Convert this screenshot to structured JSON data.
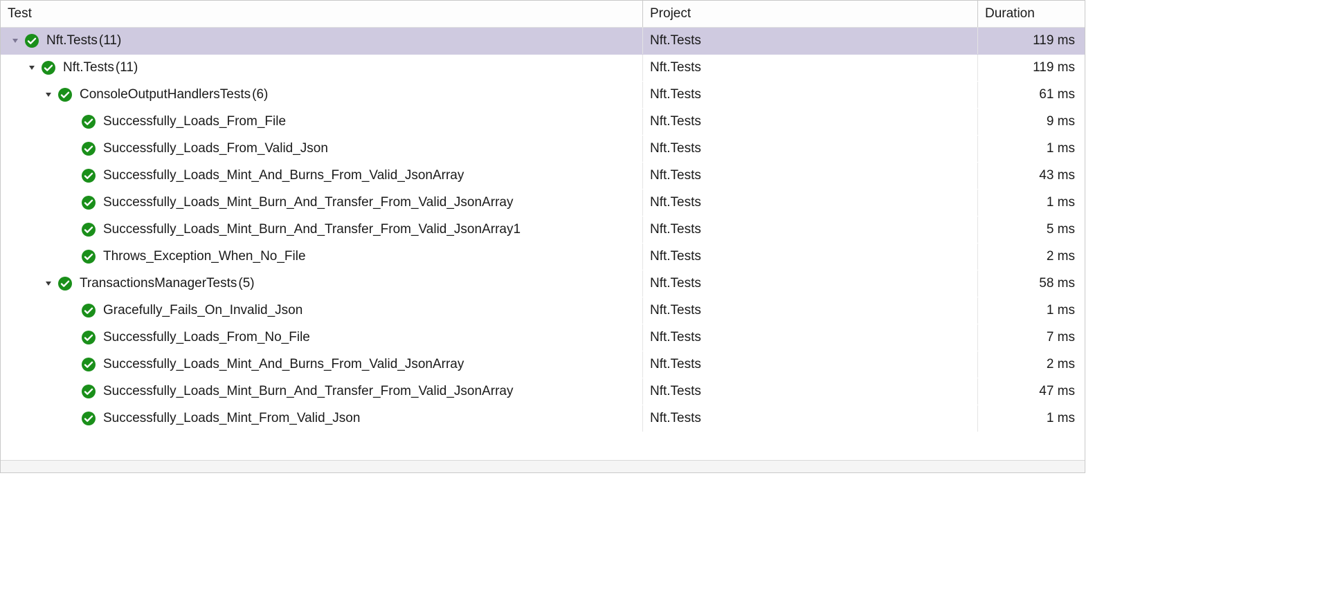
{
  "columns": {
    "test": "Test",
    "project": "Project",
    "duration": "Duration"
  },
  "rows": [
    {
      "id": "root",
      "indent": 0,
      "expander": "open-light",
      "status": "pass",
      "name": "Nft.Tests",
      "count": "(11)",
      "project": "Nft.Tests",
      "duration": "119 ms",
      "selected": true,
      "interactable": true
    },
    {
      "id": "ns",
      "indent": 1,
      "expander": "open",
      "status": "pass",
      "name": "Nft.Tests",
      "count": "(11)",
      "project": "Nft.Tests",
      "duration": "119 ms",
      "selected": false,
      "interactable": true
    },
    {
      "id": "cls1",
      "indent": 2,
      "expander": "open",
      "status": "pass",
      "name": "ConsoleOutputHandlersTests",
      "count": "(6)",
      "project": "Nft.Tests",
      "duration": "61 ms",
      "selected": false,
      "interactable": true
    },
    {
      "id": "t1",
      "indent": 3,
      "expander": "none",
      "status": "pass",
      "name": "Successfully_Loads_From_File",
      "count": "",
      "project": "Nft.Tests",
      "duration": "9 ms",
      "selected": false,
      "interactable": true
    },
    {
      "id": "t2",
      "indent": 3,
      "expander": "none",
      "status": "pass",
      "name": "Successfully_Loads_From_Valid_Json",
      "count": "",
      "project": "Nft.Tests",
      "duration": "1 ms",
      "selected": false,
      "interactable": true
    },
    {
      "id": "t3",
      "indent": 3,
      "expander": "none",
      "status": "pass",
      "name": "Successfully_Loads_Mint_And_Burns_From_Valid_JsonArray",
      "count": "",
      "project": "Nft.Tests",
      "duration": "43 ms",
      "selected": false,
      "interactable": true
    },
    {
      "id": "t4",
      "indent": 3,
      "expander": "none",
      "status": "pass",
      "name": "Successfully_Loads_Mint_Burn_And_Transfer_From_Valid_JsonArray",
      "count": "",
      "project": "Nft.Tests",
      "duration": "1 ms",
      "selected": false,
      "interactable": true
    },
    {
      "id": "t5",
      "indent": 3,
      "expander": "none",
      "status": "pass",
      "name": "Successfully_Loads_Mint_Burn_And_Transfer_From_Valid_JsonArray1",
      "count": "",
      "project": "Nft.Tests",
      "duration": "5 ms",
      "selected": false,
      "interactable": true
    },
    {
      "id": "t6",
      "indent": 3,
      "expander": "none",
      "status": "pass",
      "name": "Throws_Exception_When_No_File",
      "count": "",
      "project": "Nft.Tests",
      "duration": "2 ms",
      "selected": false,
      "interactable": true
    },
    {
      "id": "cls2",
      "indent": 2,
      "expander": "open",
      "status": "pass",
      "name": "TransactionsManagerTests",
      "count": "(5)",
      "project": "Nft.Tests",
      "duration": "58 ms",
      "selected": false,
      "interactable": true
    },
    {
      "id": "t7",
      "indent": 3,
      "expander": "none",
      "status": "pass",
      "name": "Gracefully_Fails_On_Invalid_Json",
      "count": "",
      "project": "Nft.Tests",
      "duration": "1 ms",
      "selected": false,
      "interactable": true
    },
    {
      "id": "t8",
      "indent": 3,
      "expander": "none",
      "status": "pass",
      "name": "Successfully_Loads_From_No_File",
      "count": "",
      "project": "Nft.Tests",
      "duration": "7 ms",
      "selected": false,
      "interactable": true
    },
    {
      "id": "t9",
      "indent": 3,
      "expander": "none",
      "status": "pass",
      "name": "Successfully_Loads_Mint_And_Burns_From_Valid_JsonArray",
      "count": "",
      "project": "Nft.Tests",
      "duration": "2 ms",
      "selected": false,
      "interactable": true
    },
    {
      "id": "t10",
      "indent": 3,
      "expander": "none",
      "status": "pass",
      "name": "Successfully_Loads_Mint_Burn_And_Transfer_From_Valid_JsonArray",
      "count": "",
      "project": "Nft.Tests",
      "duration": "47 ms",
      "selected": false,
      "interactable": true
    },
    {
      "id": "t11",
      "indent": 3,
      "expander": "none",
      "status": "pass",
      "name": "Successfully_Loads_Mint_From_Valid_Json",
      "count": "",
      "project": "Nft.Tests",
      "duration": "1 ms",
      "selected": false,
      "interactable": true
    }
  ]
}
